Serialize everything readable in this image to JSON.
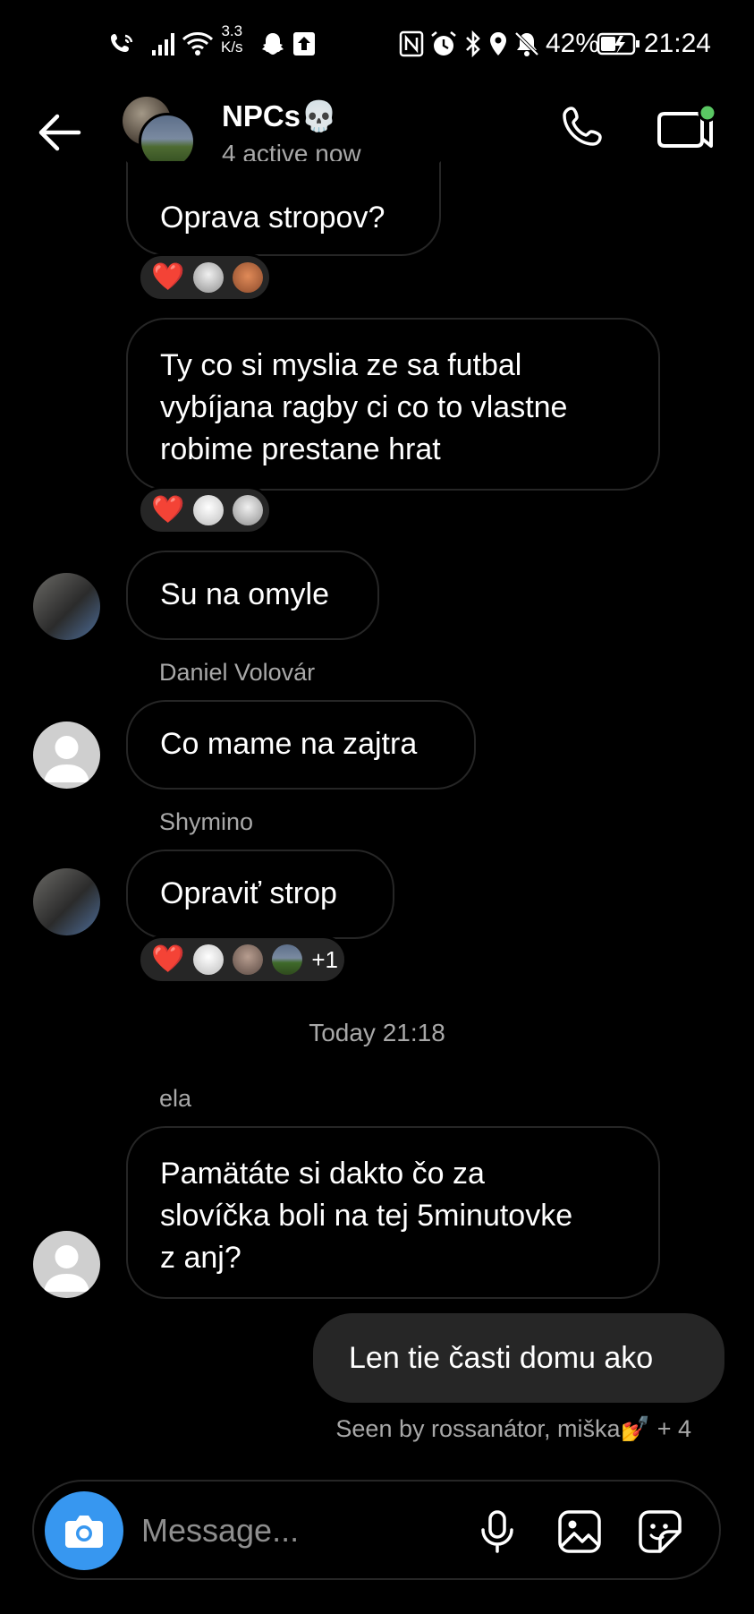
{
  "status_bar": {
    "net_speed_value": "3.3",
    "net_speed_unit": "K/s",
    "battery_text": "42%",
    "time": "21:24",
    "icons": [
      "wifi-call-icon",
      "signal-icon",
      "wifi-icon",
      "snapchat-icon",
      "upload-icon",
      "nfc-icon",
      "alarm-icon",
      "bluetooth-icon",
      "location-icon",
      "mute-icon",
      "battery-icon"
    ]
  },
  "header": {
    "title": "NPCs",
    "title_emoji": "💀",
    "subtitle": "4 active now"
  },
  "messages": [
    {
      "id": "m1",
      "sender": "",
      "text_lines": [
        "Oprava stropov?"
      ],
      "reactions": {
        "heart": "❤️",
        "count_extra": ""
      }
    },
    {
      "id": "m2",
      "sender": "",
      "text_lines": [
        "Ty co si myslia ze sa futbal",
        "vybíjana ragby ci co to vlastne",
        "robime prestane hrat"
      ],
      "reactions": {
        "heart": "❤️",
        "count_extra": ""
      }
    },
    {
      "id": "m3",
      "sender": "",
      "text_lines": [
        "Su na omyle"
      ]
    },
    {
      "id": "m4",
      "sender": "Daniel Volovár",
      "text_lines": [
        "Co mame na zajtra"
      ]
    },
    {
      "id": "m5",
      "sender": "Shymino",
      "text_lines": [
        "Opraviť strop"
      ],
      "reactions": {
        "heart": "❤️",
        "count_extra": "+1"
      }
    },
    {
      "id": "m6",
      "sender": "ela",
      "text_lines": [
        "Pamätáte si dakto čo za",
        "slovíčka boli na tej 5minutovke",
        "z anj?"
      ]
    },
    {
      "id": "m7",
      "sender": "me",
      "text_lines": [
        "Len tie časti domu ako"
      ]
    }
  ],
  "timestamp": "Today 21:18",
  "seen": {
    "text": "Seen by rossanátor, miška",
    "emoji": "💅",
    "extra": " + 4"
  },
  "composer": {
    "placeholder": "Message..."
  },
  "colors": {
    "accent_blue": "#3797f0",
    "bubble_outline": "#262626",
    "active_dot": "#5ac763",
    "heart": "#ff3040"
  }
}
